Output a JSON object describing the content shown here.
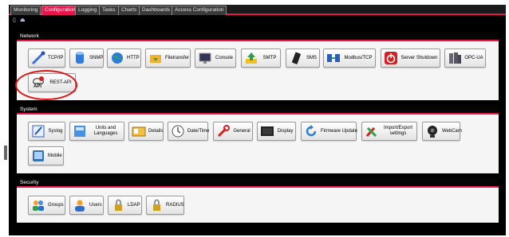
{
  "tabs": [
    "Monitoring",
    "Configuration",
    "Logging",
    "Tasks",
    "Charts",
    "Dashboards",
    "Access Configuration"
  ],
  "colors": {
    "accent": "#e8144c",
    "header": "#050505",
    "highlight": "#e01010"
  },
  "network": {
    "title": "Network",
    "buttons": [
      "TCP/IP",
      "SNMP",
      "HTTP",
      "Filetransfer",
      "Console",
      "SMTP",
      "SMS",
      "Modbus/TCP",
      "Server Shutdown",
      "OPC-UA",
      "REST-API"
    ]
  },
  "system": {
    "title": "System",
    "buttons": [
      "Syslog",
      "Units and Languages",
      "Details",
      "Date/Time",
      "General",
      "Display",
      "Firmware Update",
      "Import/Export settings",
      "WebCam",
      "Mobile"
    ]
  },
  "security": {
    "title": "Security",
    "buttons": [
      "Groups",
      "Users",
      "LDAP",
      "RADIUS"
    ]
  }
}
